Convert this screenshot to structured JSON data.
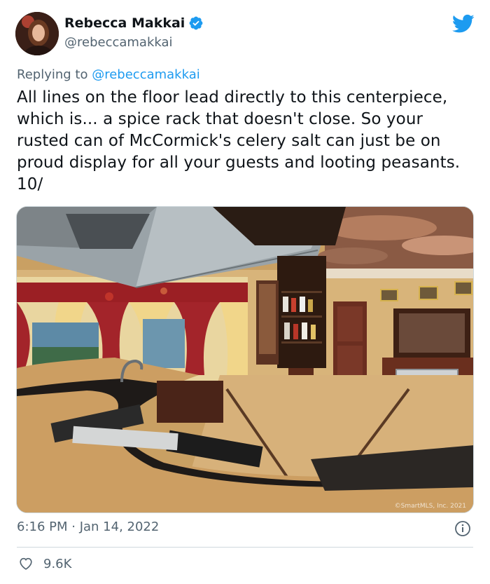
{
  "author": {
    "display_name": "Rebecca Makkai",
    "handle": "@rebeccamakkai",
    "verified": true
  },
  "reply": {
    "prefix": "Replying to",
    "mention": "@rebeccamakkai"
  },
  "tweet_text": "All lines on the floor lead directly to this centerpiece, which is... a spice rack that doesn't close. So your rusted can of McCormick's celery salt can just be on proud display for all your guests and looting peasants. 10/",
  "media": {
    "watermark": "©SmartMLS, Inc. 2021"
  },
  "timestamp": "6:16 PM · Jan 14, 2022",
  "likes": {
    "count": "9.6K"
  },
  "icons": {
    "brand": "twitter-bird-icon",
    "verified": "verified-badge-icon",
    "info": "info-icon",
    "like": "heart-icon"
  },
  "colors": {
    "accent": "#1d9bf0",
    "secondary_text": "#536471",
    "border": "#cfd9de"
  }
}
